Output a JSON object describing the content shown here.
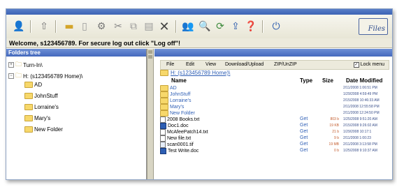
{
  "toolbar": {
    "icons": [
      "user-icon",
      "up-arrow-icon",
      "folder-icon",
      "new-document-icon",
      "properties-icon",
      "cut-icon",
      "copy-icon",
      "paste-icon",
      "delete-icon",
      "users-icon",
      "search-icon",
      "refresh-icon",
      "upload-icon",
      "help-icon",
      "logoff-icon"
    ],
    "logo_text": "Files"
  },
  "welcome_text": "Welcome, s123456789. For secure log out click \"Log off\"!",
  "left_pane": {
    "header": "Folders tree",
    "nodes": [
      {
        "label": "Turn-In\\",
        "expander": "+"
      },
      {
        "label": "H: (s123456789 Home)\\",
        "expander": "−"
      },
      {
        "label": "AD"
      },
      {
        "label": "JohnStuff"
      },
      {
        "label": "Lorraine's"
      },
      {
        "label": "Mary's"
      },
      {
        "label": "New Folder"
      }
    ]
  },
  "right_pane": {
    "menu": [
      "File",
      "Edit",
      "View",
      "Download/Upload",
      "ZIP/UnZIP"
    ],
    "lock_menu_label": "Lock menu",
    "lock_menu_checked": "✓",
    "current_path": "H: (s123456789 Home)\\",
    "columns": [
      "Name",
      "Type",
      "Size",
      "Date Modified"
    ],
    "rows": [
      {
        "name": "AD",
        "type": "",
        "size": "",
        "date": "2/11/2008 1:06:51 PM"
      },
      {
        "name": "JohnStuff",
        "type": "",
        "size": "",
        "date": "1/29/2008 4:59:49 PM"
      },
      {
        "name": "Lorraine's",
        "type": "",
        "size": "",
        "date": "2/15/2008 10:46:33 AM"
      },
      {
        "name": "Mary's",
        "type": "",
        "size": "",
        "date": "2/11/2008 12:55:58 PM"
      },
      {
        "name": "New Folder",
        "type": "",
        "size": "",
        "date": "2/11/2008 12:24:50 PM"
      },
      {
        "name": "2008 Books.txt",
        "type": "Get",
        "size": "803 b",
        "date": "1/25/2008 9:51:20 AM"
      },
      {
        "name": "Doc1.doc",
        "type": "Get",
        "size": "19 KB",
        "date": "2/15/2008 9:26:02 AM"
      },
      {
        "name": "McAfeePatch14.txt",
        "type": "Get",
        "size": "21 b",
        "date": "1/29/2008 10:17:1"
      },
      {
        "name": "New file.txt",
        "type": "Get",
        "size": "9 b",
        "date": "2/11/2008 1:00:23"
      },
      {
        "name": "scan0001.tif",
        "type": "Get",
        "size": "19 MB",
        "date": "2/11/2008 3:13:58 PM"
      },
      {
        "name": "Test Write.doc",
        "type": "Get",
        "size": "0 b",
        "date": "1/25/2008 9:10:37 AM"
      }
    ]
  }
}
